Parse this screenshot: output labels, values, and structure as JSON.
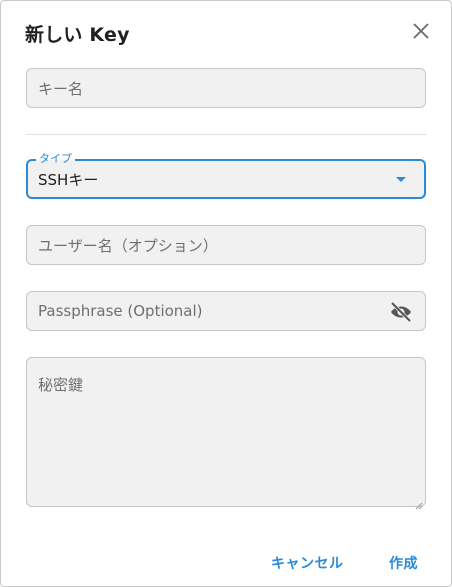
{
  "dialog": {
    "title": "新しい Key",
    "fields": {
      "key_name_placeholder": "キー名",
      "type_label": "タイプ",
      "type_value": "SSHキー",
      "username_placeholder": "ユーザー名（オプション）",
      "passphrase_placeholder": "Passphrase (Optional)",
      "private_key_placeholder": "秘密鍵"
    },
    "buttons": {
      "cancel": "キャンセル",
      "create": "作成"
    }
  },
  "icons": {
    "close": "close-icon",
    "dropdown": "chevron-down-icon",
    "visibility": "eye-off-icon"
  },
  "colors": {
    "accent": "#2a8ad7",
    "field_bg": "#f1f1f1"
  }
}
